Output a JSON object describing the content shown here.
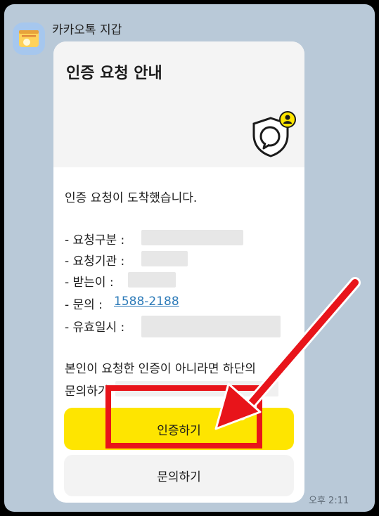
{
  "sender": {
    "name": "카카오톡 지갑"
  },
  "card": {
    "title": "인증 요청 안내",
    "intro": "인증 요청이 도착했습니다.",
    "rows": [
      {
        "label": "- 요청구분 :",
        "value": ""
      },
      {
        "label": "- 요청기관 :",
        "value": ""
      },
      {
        "label": "- 받는이 :",
        "value": ""
      },
      {
        "label": "- 문의 :",
        "value": "1588-2188"
      },
      {
        "label": "- 유효일시 :",
        "value": ""
      }
    ],
    "notice_line1": "본인이 요청한 인증이 아니라면 하단의",
    "notice_line2": "문의하기",
    "primary_button": "인증하기",
    "secondary_button": "문의하기"
  },
  "timestamp": "오후 2:11",
  "colors": {
    "chat_background": "#b9c9d8",
    "kakao_yellow": "#fee500",
    "annotation_red": "#e8141a",
    "link_blue": "#2c7ab8"
  },
  "icons": [
    "wallet-icon",
    "shield-chat-icon",
    "user-badge-icon",
    "annotation-arrow"
  ]
}
